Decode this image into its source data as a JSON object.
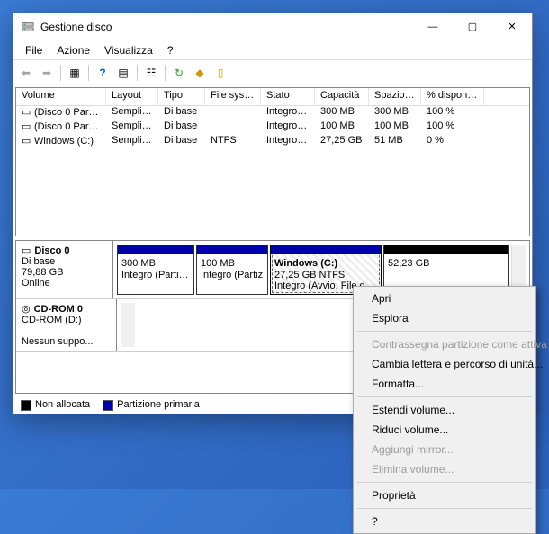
{
  "window": {
    "title": "Gestione disco",
    "buttons": {
      "min": "—",
      "max": "▢",
      "close": "✕"
    }
  },
  "menubar": [
    "File",
    "Azione",
    "Visualizza",
    "?"
  ],
  "volumes": {
    "headers": [
      "Volume",
      "Layout",
      "Tipo",
      "File system",
      "Stato",
      "Capacità",
      "Spazio d...",
      "% disponibile"
    ],
    "rows": [
      {
        "name": "(Disco 0 Partizione...",
        "layout": "Semplice",
        "type": "Di base",
        "fs": "",
        "state": "Integro (P...",
        "cap": "300 MB",
        "free": "300 MB",
        "pct": "100 %"
      },
      {
        "name": "(Disco 0 Partizione...",
        "layout": "Semplice",
        "type": "Di base",
        "fs": "",
        "state": "Integro (P...",
        "cap": "100 MB",
        "free": "100 MB",
        "pct": "100 %"
      },
      {
        "name": "Windows (C:)",
        "layout": "Semplice",
        "type": "Di base",
        "fs": "NTFS",
        "state": "Integro (A...",
        "cap": "27,25 GB",
        "free": "51 MB",
        "pct": "0 %"
      }
    ]
  },
  "disks": [
    {
      "label_title": "Disco 0",
      "label_sub1": "Di base",
      "label_sub2": "79,88 GB",
      "label_sub3": "Online",
      "parts": [
        {
          "kind": "primary",
          "w": 86,
          "l1": "",
          "l2": "300 MB",
          "l3": "Integro (Partizione"
        },
        {
          "kind": "primary",
          "w": 80,
          "l1": "",
          "l2": "100 MB",
          "l3": "Integro (Partiz"
        },
        {
          "kind": "primary selected",
          "w": 124,
          "l1": "Windows  (C:)",
          "l2": "27,25 GB NTFS",
          "l3": "Integro (Avvio, File di pagina"
        },
        {
          "kind": "unalloc",
          "w": 140,
          "l1": "",
          "l2": "52,23 GB",
          "l3": ""
        }
      ]
    },
    {
      "label_title": "CD-ROM 0",
      "label_sub1": "CD-ROM (D:)",
      "label_sub2": "",
      "label_sub3": "Nessun suppo...",
      "parts": []
    }
  ],
  "legend": {
    "unallocated": "Non allocata",
    "primary": "Partizione primaria"
  },
  "contextmenu": [
    {
      "label": "Apri",
      "enabled": true
    },
    {
      "label": "Esplora",
      "enabled": true
    },
    {
      "sep": true
    },
    {
      "label": "Contrassegna partizione come attiva",
      "enabled": false
    },
    {
      "label": "Cambia lettera e percorso di unità...",
      "enabled": true
    },
    {
      "label": "Formatta...",
      "enabled": true
    },
    {
      "sep": true
    },
    {
      "label": "Estendi volume...",
      "enabled": true
    },
    {
      "label": "Riduci volume...",
      "enabled": true
    },
    {
      "label": "Aggiungi mirror...",
      "enabled": false
    },
    {
      "label": "Elimina volume...",
      "enabled": false
    },
    {
      "sep": true
    },
    {
      "label": "Proprietà",
      "enabled": true
    },
    {
      "sep": true
    },
    {
      "label": "?",
      "enabled": true
    }
  ]
}
